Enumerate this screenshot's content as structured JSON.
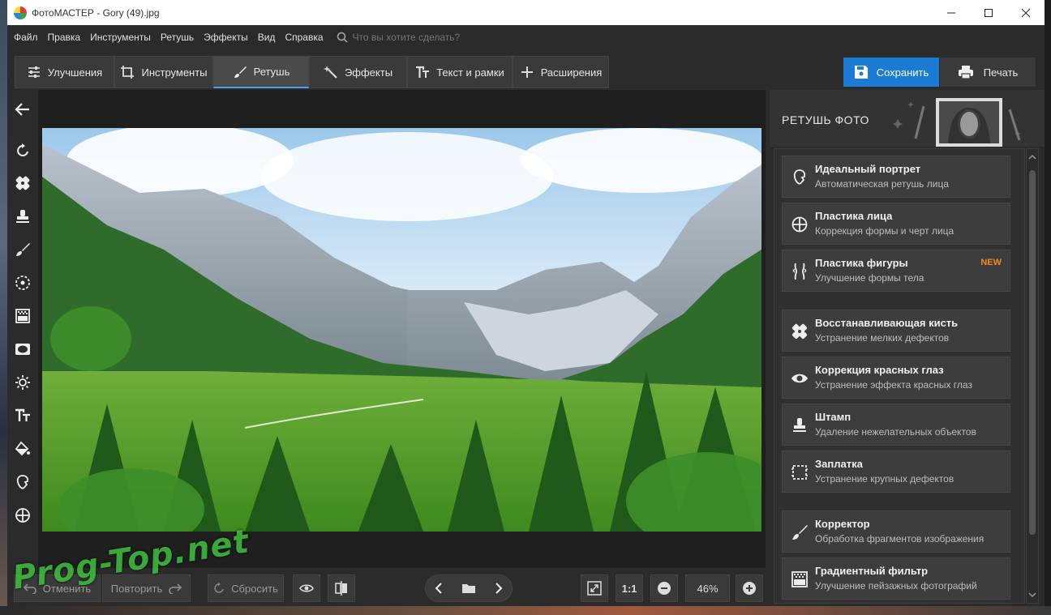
{
  "window": {
    "title": "ФотоМАСТЕР - Gory (49).jpg"
  },
  "menu": [
    "Файл",
    "Правка",
    "Инструменты",
    "Ретушь",
    "Эффекты",
    "Вид",
    "Справка"
  ],
  "search": {
    "placeholder": "Что вы хотите сделать?"
  },
  "tabs": [
    {
      "label": "Улучшения",
      "icon": "sliders-icon"
    },
    {
      "label": "Инструменты",
      "icon": "crop-icon"
    },
    {
      "label": "Ретушь",
      "icon": "brush-icon",
      "active": true
    },
    {
      "label": "Эффекты",
      "icon": "magic-wand-icon"
    },
    {
      "label": "Текст и рамки",
      "icon": "text-icon"
    },
    {
      "label": "Расширения",
      "icon": "plus-icon"
    }
  ],
  "actions": {
    "save": "Сохранить",
    "print": "Печать"
  },
  "panel": {
    "title": "РЕТУШЬ ФОТО",
    "tools": [
      {
        "name": "Идеальный портрет",
        "desc": "Автоматическая ретушь лица",
        "badge": ""
      },
      {
        "name": "Пластика лица",
        "desc": "Коррекция формы и черт лица",
        "badge": ""
      },
      {
        "name": "Пластика фигуры",
        "desc": "Улучшение формы тела",
        "badge": "NEW"
      },
      {
        "name": "Восстанавливающая кисть",
        "desc": "Устранение мелких дефектов",
        "badge": ""
      },
      {
        "name": "Коррекция красных глаз",
        "desc": "Устранение эффекта красных глаз",
        "badge": ""
      },
      {
        "name": "Штамп",
        "desc": "Удаление нежелательных объектов",
        "badge": ""
      },
      {
        "name": "Заплатка",
        "desc": "Устранение крупных дефектов",
        "badge": ""
      },
      {
        "name": "Корректор",
        "desc": "Обработка фрагментов изображения",
        "badge": ""
      },
      {
        "name": "Градиентный фильтр",
        "desc": "Улучшение пейзажных фотографий",
        "badge": ""
      }
    ]
  },
  "bottom": {
    "undo": "Отменить",
    "redo": "Повторить",
    "reset": "Сбросить",
    "actual_size": "1:1",
    "zoom": "46%"
  },
  "watermark": "Prog-Top.net",
  "colors": {
    "accent": "#1a7ad4",
    "new_badge": "#f08a20",
    "bg": "#2b2b2b"
  }
}
